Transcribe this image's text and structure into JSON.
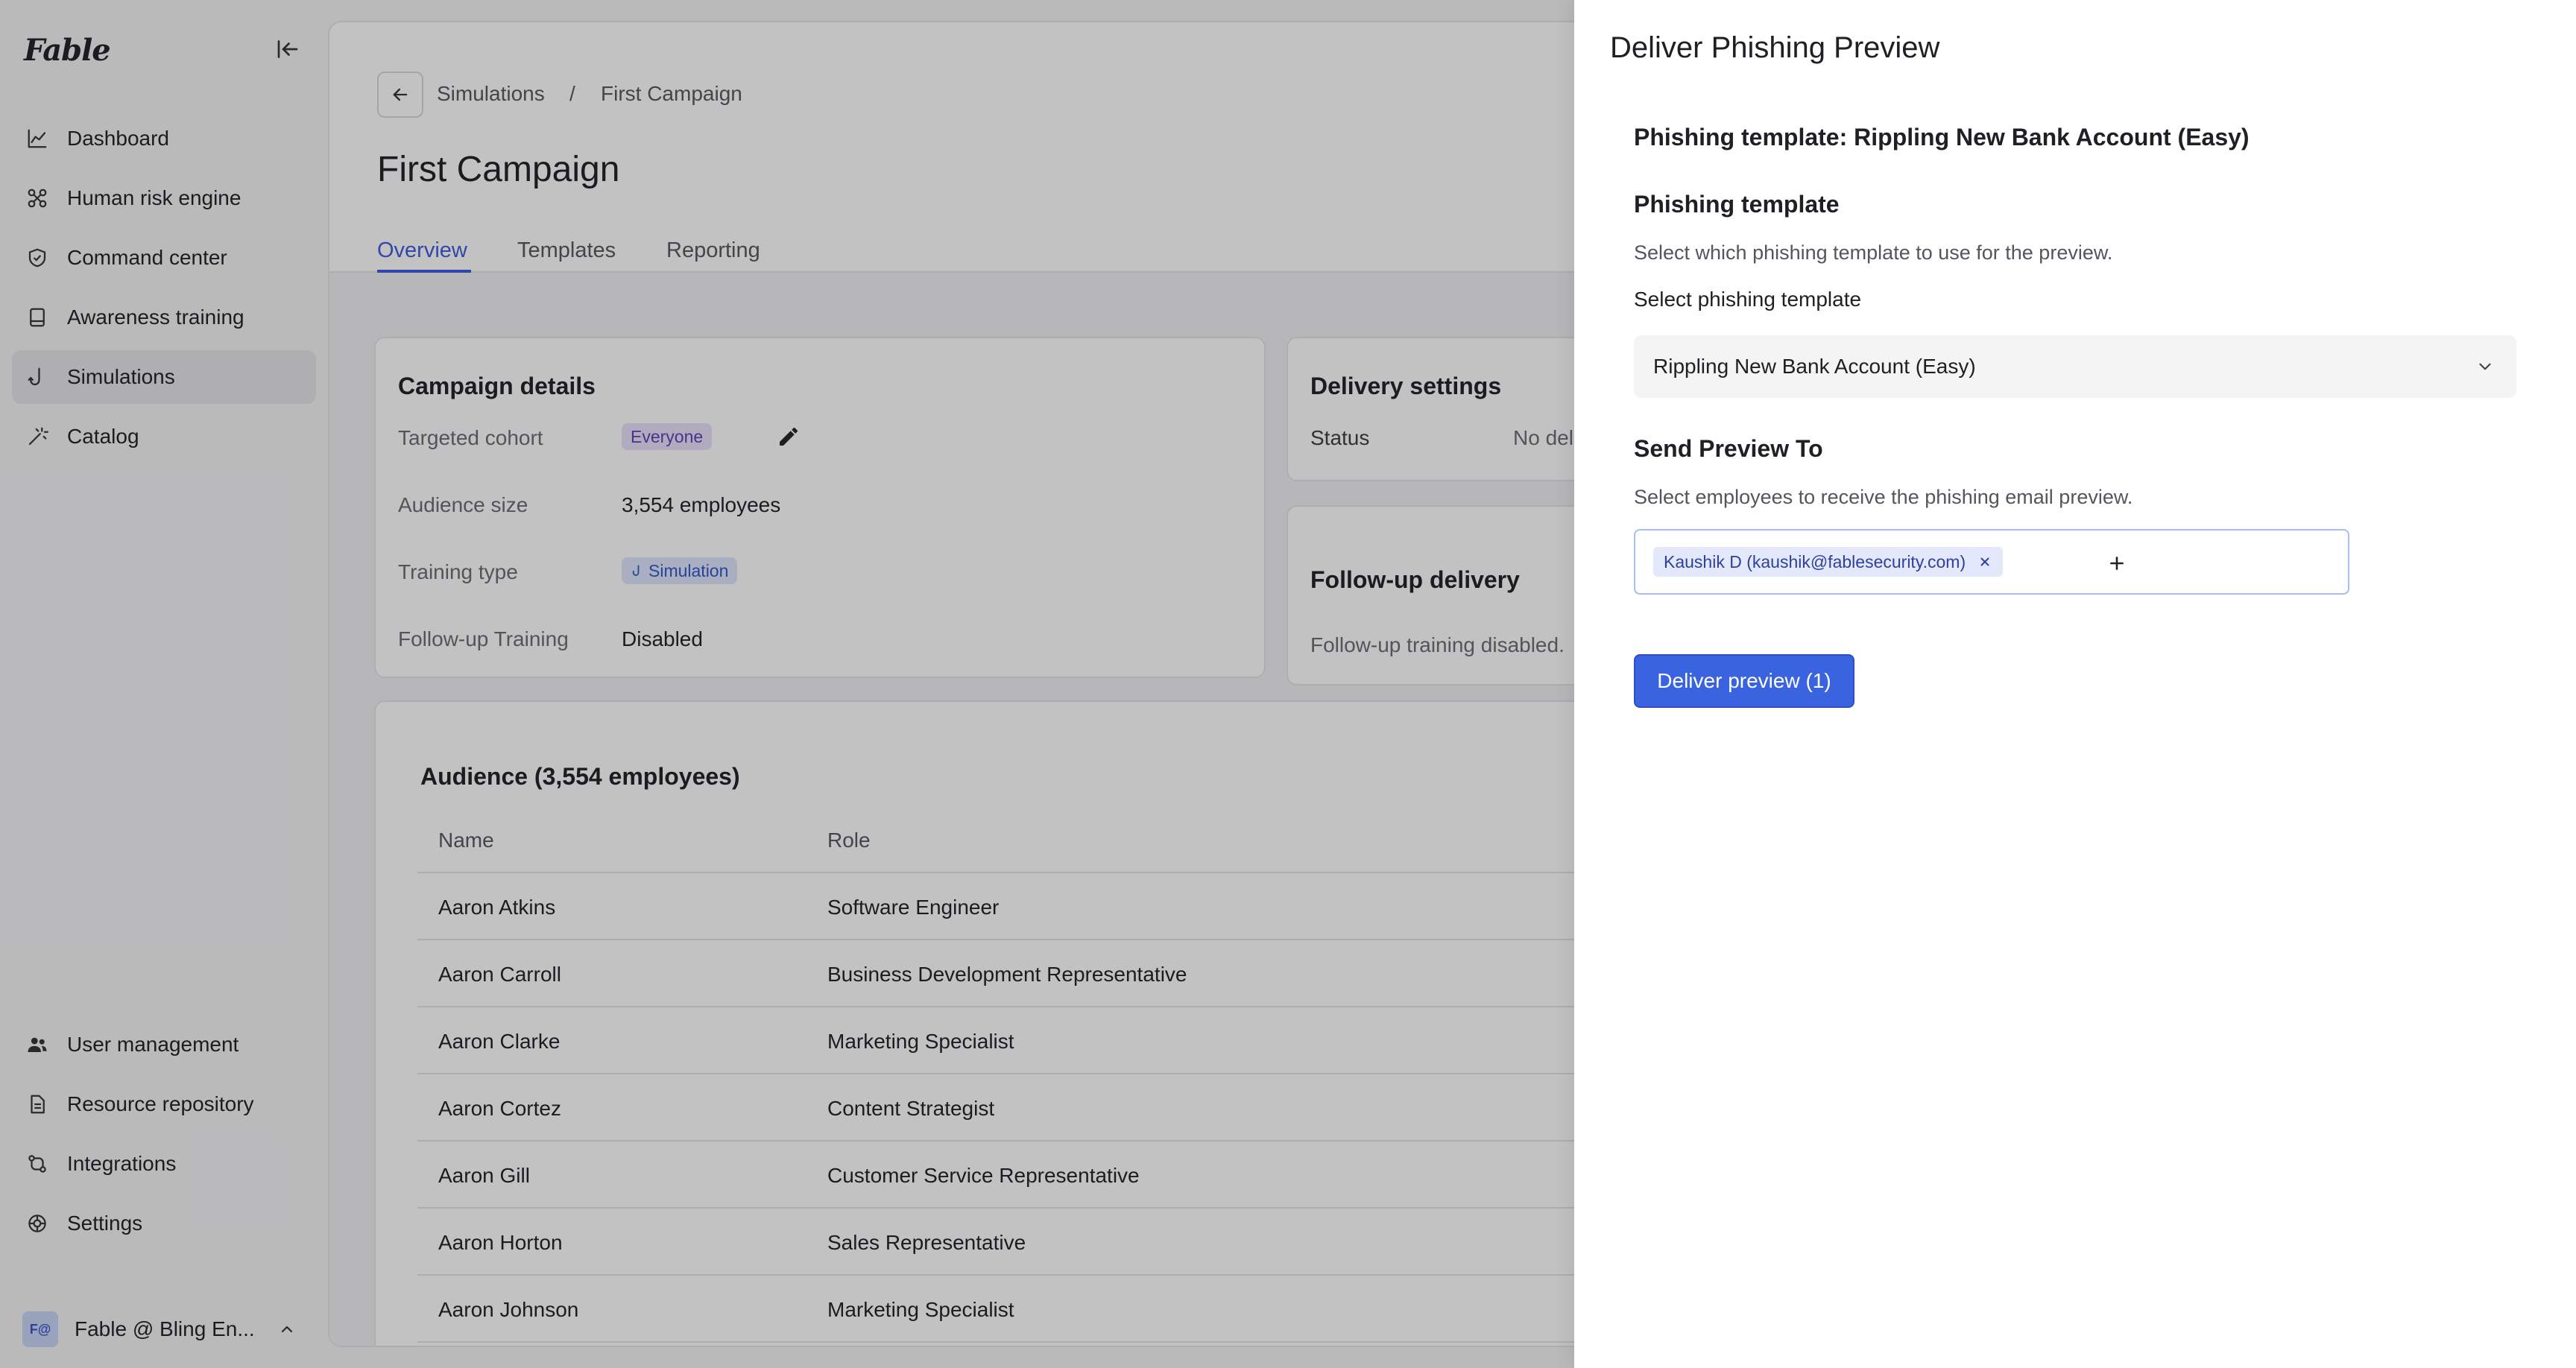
{
  "app": {
    "logo": "Fable"
  },
  "sidebar": {
    "top_items": [
      {
        "label": "Dashboard",
        "icon": "chart-line-icon"
      },
      {
        "label": "Human risk engine",
        "icon": "network-icon"
      },
      {
        "label": "Command center",
        "icon": "shield-check-icon"
      },
      {
        "label": "Awareness training",
        "icon": "book-icon"
      },
      {
        "label": "Simulations",
        "icon": "hook-icon",
        "active": true
      },
      {
        "label": "Catalog",
        "icon": "magic-wand-icon"
      }
    ],
    "bottom_items": [
      {
        "label": "User management",
        "icon": "users-icon"
      },
      {
        "label": "Resource repository",
        "icon": "document-icon"
      },
      {
        "label": "Integrations",
        "icon": "git-pull-icon"
      },
      {
        "label": "Settings",
        "icon": "gear-icon"
      }
    ],
    "workspace": {
      "avatar": "F@",
      "name": "Fable @ Bling En..."
    }
  },
  "breadcrumb": {
    "parent": "Simulations",
    "separator": "/",
    "current": "First Campaign"
  },
  "page": {
    "title": "First Campaign"
  },
  "tabs": [
    {
      "label": "Overview",
      "active": true
    },
    {
      "label": "Templates"
    },
    {
      "label": "Reporting"
    }
  ],
  "campaign_details": {
    "title": "Campaign details",
    "targeted_cohort_label": "Targeted cohort",
    "targeted_cohort_value": "Everyone",
    "audience_size_label": "Audience size",
    "audience_size_value": "3,554 employees",
    "training_type_label": "Training type",
    "training_type_value": "Simulation",
    "followup_label": "Follow-up Training",
    "followup_value": "Disabled"
  },
  "delivery_settings": {
    "title": "Delivery settings",
    "status_label": "Status",
    "status_value": "No del"
  },
  "followup_delivery": {
    "title": "Follow-up delivery",
    "text": "Follow-up training disabled."
  },
  "audience": {
    "title": "Audience (3,554 employees)",
    "columns": [
      "Name",
      "Role"
    ],
    "rows": [
      {
        "name": "Aaron Atkins",
        "role": "Software Engineer"
      },
      {
        "name": "Aaron Carroll",
        "role": "Business Development Representative"
      },
      {
        "name": "Aaron Clarke",
        "role": "Marketing Specialist"
      },
      {
        "name": "Aaron Cortez",
        "role": "Content Strategist"
      },
      {
        "name": "Aaron Gill",
        "role": "Customer Service Representative"
      },
      {
        "name": "Aaron Horton",
        "role": "Sales Representative"
      },
      {
        "name": "Aaron Johnson",
        "role": "Marketing Specialist"
      }
    ]
  },
  "drawer": {
    "title": "Deliver Phishing Preview",
    "template_heading": "Phishing template: Rippling New Bank Account (Easy)",
    "template_section": "Phishing template",
    "template_help": "Select which phishing template to use for the preview.",
    "select_label": "Select phishing template",
    "select_value": "Rippling New Bank Account (Easy)",
    "send_section": "Send Preview To",
    "send_help": "Select employees to receive the phishing email preview.",
    "recipient_tag": "Kaushik D (kaushik@fablesecurity.com)",
    "deliver_button": "Deliver preview (1)"
  },
  "colors": {
    "accent": "#3a63e0",
    "cohort_chip": "#e7e0f9",
    "training_chip": "#dde6fb"
  }
}
